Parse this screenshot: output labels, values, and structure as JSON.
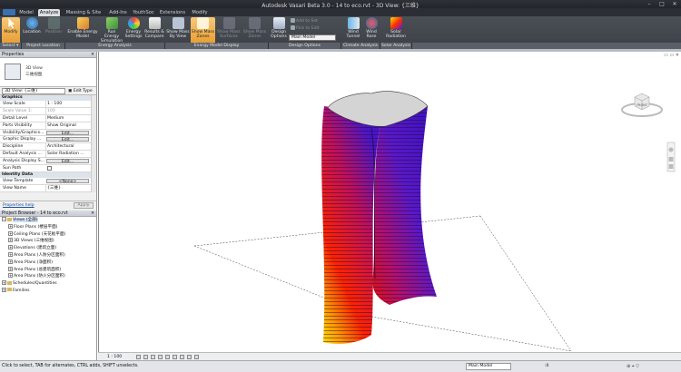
{
  "window": {
    "title": "Autodesk Vasari Beta 3.0 -     14 to eco.rvt - 3D View: {三维}"
  },
  "tabs": [
    "Model",
    "Analyze",
    "Massing & Site",
    "Add-Ins",
    "YouthSoc",
    "Extensions",
    "Modify"
  ],
  "active_tab": "Analyze",
  "ribbon": {
    "modify": "Modify",
    "location": "Location",
    "position": "Position",
    "enable_energy_model": "Enable Energy Model",
    "run_energy_simulation": "Run Energy Simulation",
    "energy_settings": "Energy Settings",
    "results_compare": "Results & Compare",
    "show_mass_by_view": "Show Mass By View",
    "show_mass_zones": "Show Mass Zones",
    "show_mass_surfaces": "Show Mass Surfaces",
    "show_mass_zones2": "Show Mass Zones",
    "design_options": "Design Options",
    "add_to_set": "Add to Set",
    "pick_to_edit": "Pick to Edit",
    "main_model": "Main Model",
    "wind_tunnel": "Wind Tunnel",
    "wind_rose": "Wind Rose",
    "solar_radiation": "Solar Radiation"
  },
  "panels": [
    "Select ▾",
    "Project Location",
    "Energy Analysis",
    "Energy Model Display",
    "Design Options",
    "Climate Analysis",
    "Solar Analysis"
  ],
  "properties": {
    "title": "Properties",
    "type_name": "3D View",
    "type_sub": "三维视图",
    "view_selector": "3D View: {三维}",
    "edit_type": "Edit Type",
    "section_graphics": "Graphics",
    "section_identity": "Identity Data",
    "rows": [
      {
        "k": "View Scale",
        "v": "1 : 100"
      },
      {
        "k": "Scale Value    1:",
        "v": "100"
      },
      {
        "k": "Detail Level",
        "v": "Medium"
      },
      {
        "k": "Parts Visibility",
        "v": "Show Original"
      },
      {
        "k": "Visibility/Graphics...",
        "v": "Edit..."
      },
      {
        "k": "Graphic Display ...",
        "v": "Edit..."
      },
      {
        "k": "Discipline",
        "v": "Architectural"
      },
      {
        "k": "Default Analysis ...",
        "v": "Solar Radiation ..."
      },
      {
        "k": "Analysis Display S...",
        "v": "Edit..."
      },
      {
        "k": "Sun Path",
        "v": ""
      }
    ],
    "identity_rows": [
      {
        "k": "View Template",
        "v": "<None>"
      },
      {
        "k": "View Name",
        "v": "{三维}"
      }
    ],
    "help": "Properties help",
    "apply": "Apply"
  },
  "browser": {
    "title": "Project Browser - 14 to eco.rvt",
    "views_root": "Views (全部)",
    "items": [
      "Floor Plans (楼层平面)",
      "Ceiling Plans (天花板平面)",
      "3D Views (三维视图)",
      "Elevations (建筑立面)",
      "Area Plans (人防分区面积)",
      "Area Plans (净面积)",
      "Area Plans (总建筑面积)",
      "Area Plans (防火分区面积)"
    ],
    "schedules": "Schedules/Quantities",
    "families": "Families"
  },
  "viewport": {
    "scale": "1 : 100",
    "cube_label": "FRONT",
    "colors": {
      "hot": "#ffe000",
      "mid": "#ff2200",
      "cool": "#4a16c8",
      "roof": "#d4d4d4"
    }
  },
  "status": {
    "message": "Click to select, TAB for alternates, CTRL adds, SHIFT unselects.",
    "workset": "Main Model",
    "counter": ":0"
  }
}
